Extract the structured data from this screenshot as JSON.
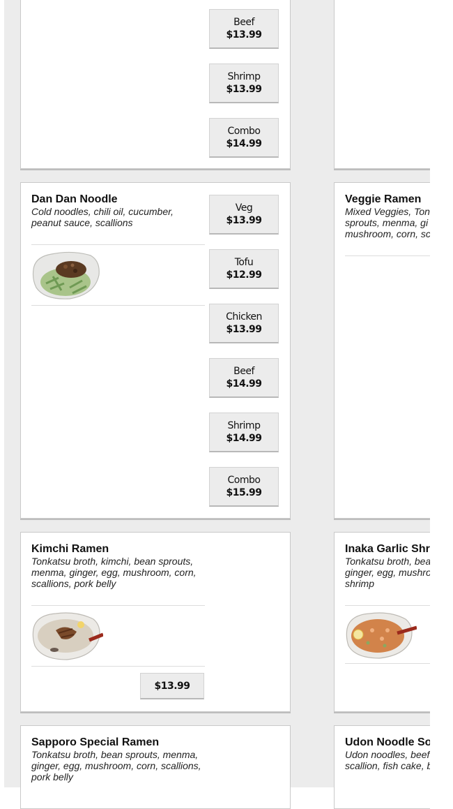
{
  "cards": {
    "top_left": {
      "options": [
        {
          "name": "Beef",
          "price": "$13.99"
        },
        {
          "name": "Shrimp",
          "price": "$13.99"
        },
        {
          "name": "Combo",
          "price": "$14.99"
        }
      ]
    },
    "dan_dan": {
      "title": "Dan Dan Noodle",
      "desc": "Cold noodles, chili oil, cucumber, peanut sauce, scallions",
      "options": [
        {
          "name": "Veg",
          "price": "$13.99"
        },
        {
          "name": "Tofu",
          "price": "$12.99"
        },
        {
          "name": "Chicken",
          "price": "$13.99"
        },
        {
          "name": "Beef",
          "price": "$14.99"
        },
        {
          "name": "Shrimp",
          "price": "$14.99"
        },
        {
          "name": "Combo",
          "price": "$15.99"
        }
      ]
    },
    "veggie_ramen": {
      "title": "Veggie Ramen",
      "desc_lines": [
        "Mixed Veggies, Ton",
        "sprouts, menma, gi",
        "mushroom, corn, sc"
      ]
    },
    "kimchi": {
      "title": "Kimchi Ramen",
      "desc": "Tonkatsu broth, kimchi, bean sprouts, menma, ginger, egg, mushroom, corn, scallions, pork belly",
      "price": "$13.99"
    },
    "inaka": {
      "title": "Inaka Garlic Shr",
      "desc_lines": [
        "Tonkatsu broth, bea",
        "ginger, egg, mushro",
        "shrimp"
      ]
    },
    "sapporo": {
      "title": "Sapporo Special Ramen",
      "desc": "Tonkatsu broth, bean sprouts, menma, ginger, egg, mushroom, corn, scallions, pork belly"
    },
    "udon": {
      "title": "Udon Noodle So",
      "desc_lines": [
        "Udon noodles, beef",
        "scallion, fish cake, b"
      ]
    }
  },
  "icons": [
    "dan-dan-noodle-photo",
    "kimchi-ramen-photo",
    "inaka-garlic-shrimp-photo"
  ]
}
